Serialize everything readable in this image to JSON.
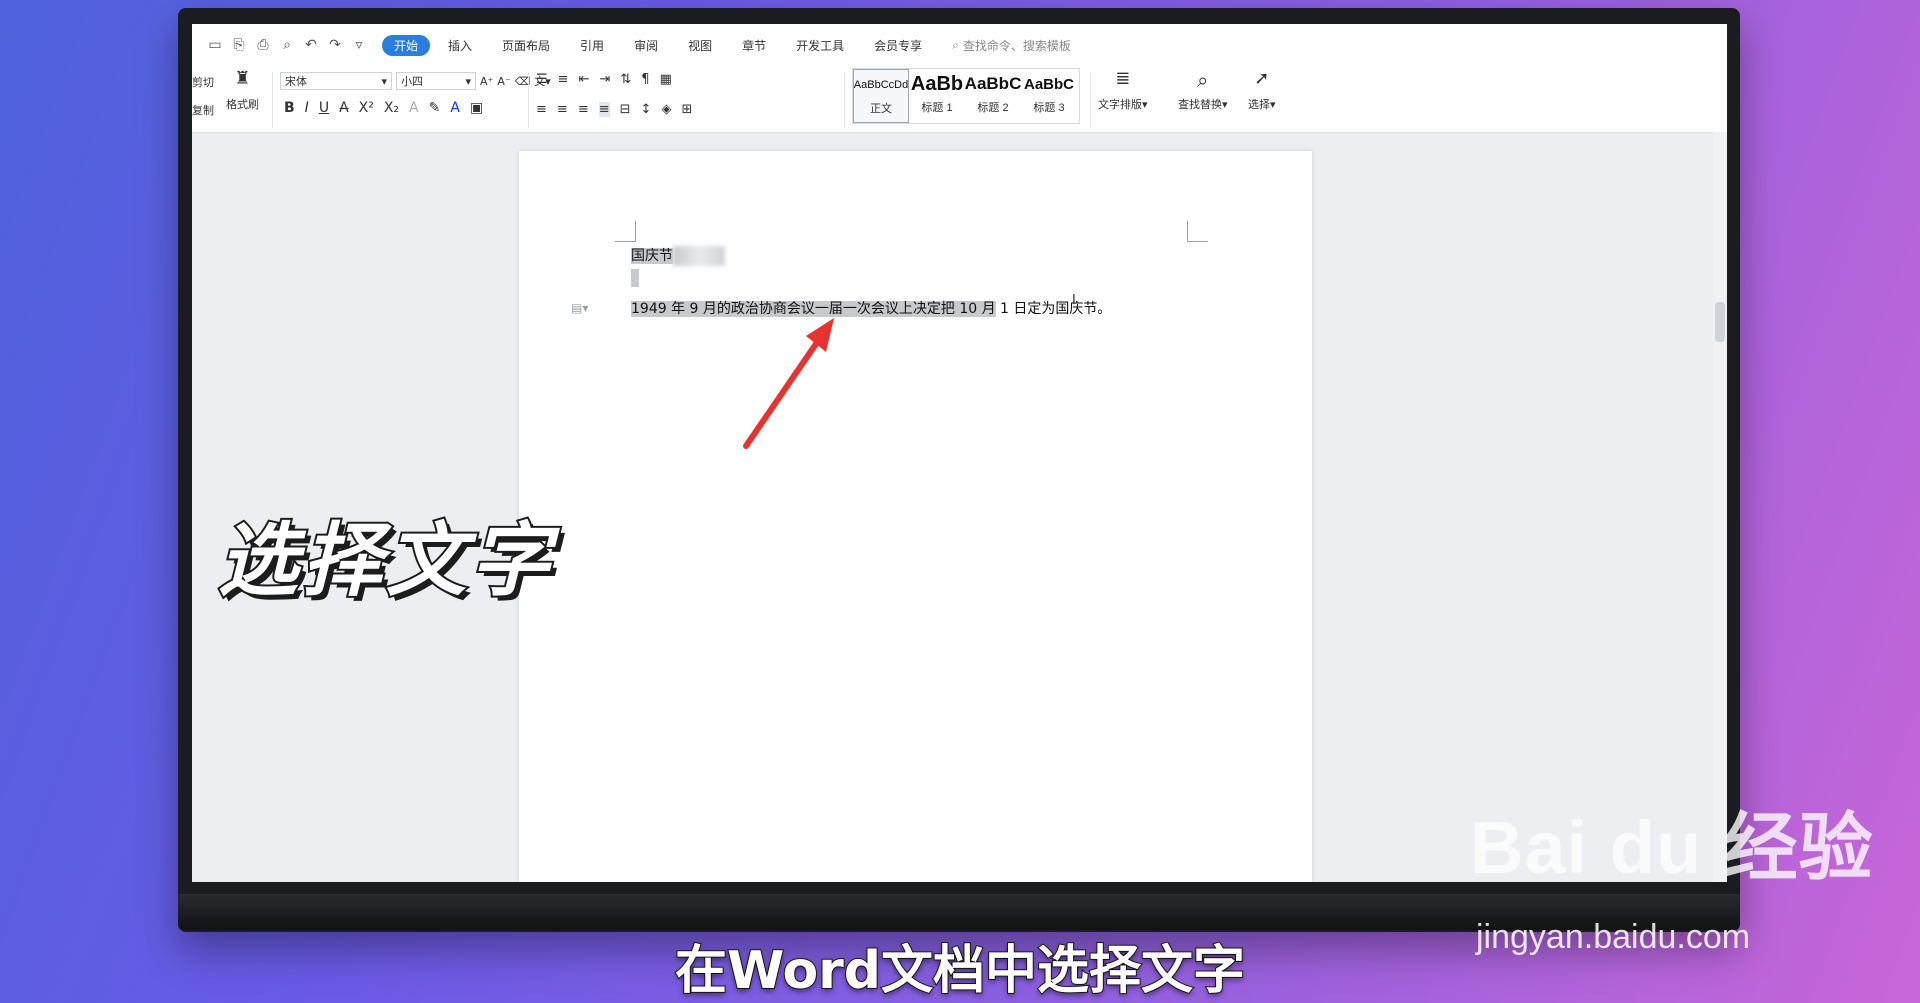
{
  "quick_access": [
    "save-icon",
    "export-icon",
    "print-icon",
    "preview-icon",
    "undo-icon",
    "redo-icon",
    "more-icon"
  ],
  "tabs": [
    "开始",
    "插入",
    "页面布局",
    "引用",
    "审阅",
    "视图",
    "章节",
    "开发工具",
    "会员专享"
  ],
  "search_placeholder": "查找命令、搜索模板",
  "clipboard": {
    "cut": "剪切",
    "copy": "复制",
    "format_painter": "格式刷"
  },
  "font": {
    "name": "宋体",
    "size": "小四"
  },
  "styles": [
    {
      "sample": "AaBbCcDd",
      "label": "正文"
    },
    {
      "sample": "AaBb",
      "label": "标题 1"
    },
    {
      "sample": "AaBbC",
      "label": "标题 2"
    },
    {
      "sample": "AaBbC",
      "label": "标题 3"
    }
  ],
  "tools": {
    "text_layout": "文字排版",
    "find_replace": "查找替换",
    "select": "选择"
  },
  "doc": {
    "title": "国庆节",
    "line_selected": "1949 年 9 月的政治协商会议一届一次会议上决定把 10 月",
    "line_rest": " 1 日定为国庆节。"
  },
  "overlay": {
    "big_caption": "选择文字",
    "subtitle": "在Word文档中选择文字",
    "watermark": "Bai du 经验",
    "watermark_url": "jingyan.baidu.com"
  },
  "colors": {
    "accent": "#2a7de1",
    "selection": "#c7c9cc",
    "arrow": "#e8322f"
  }
}
